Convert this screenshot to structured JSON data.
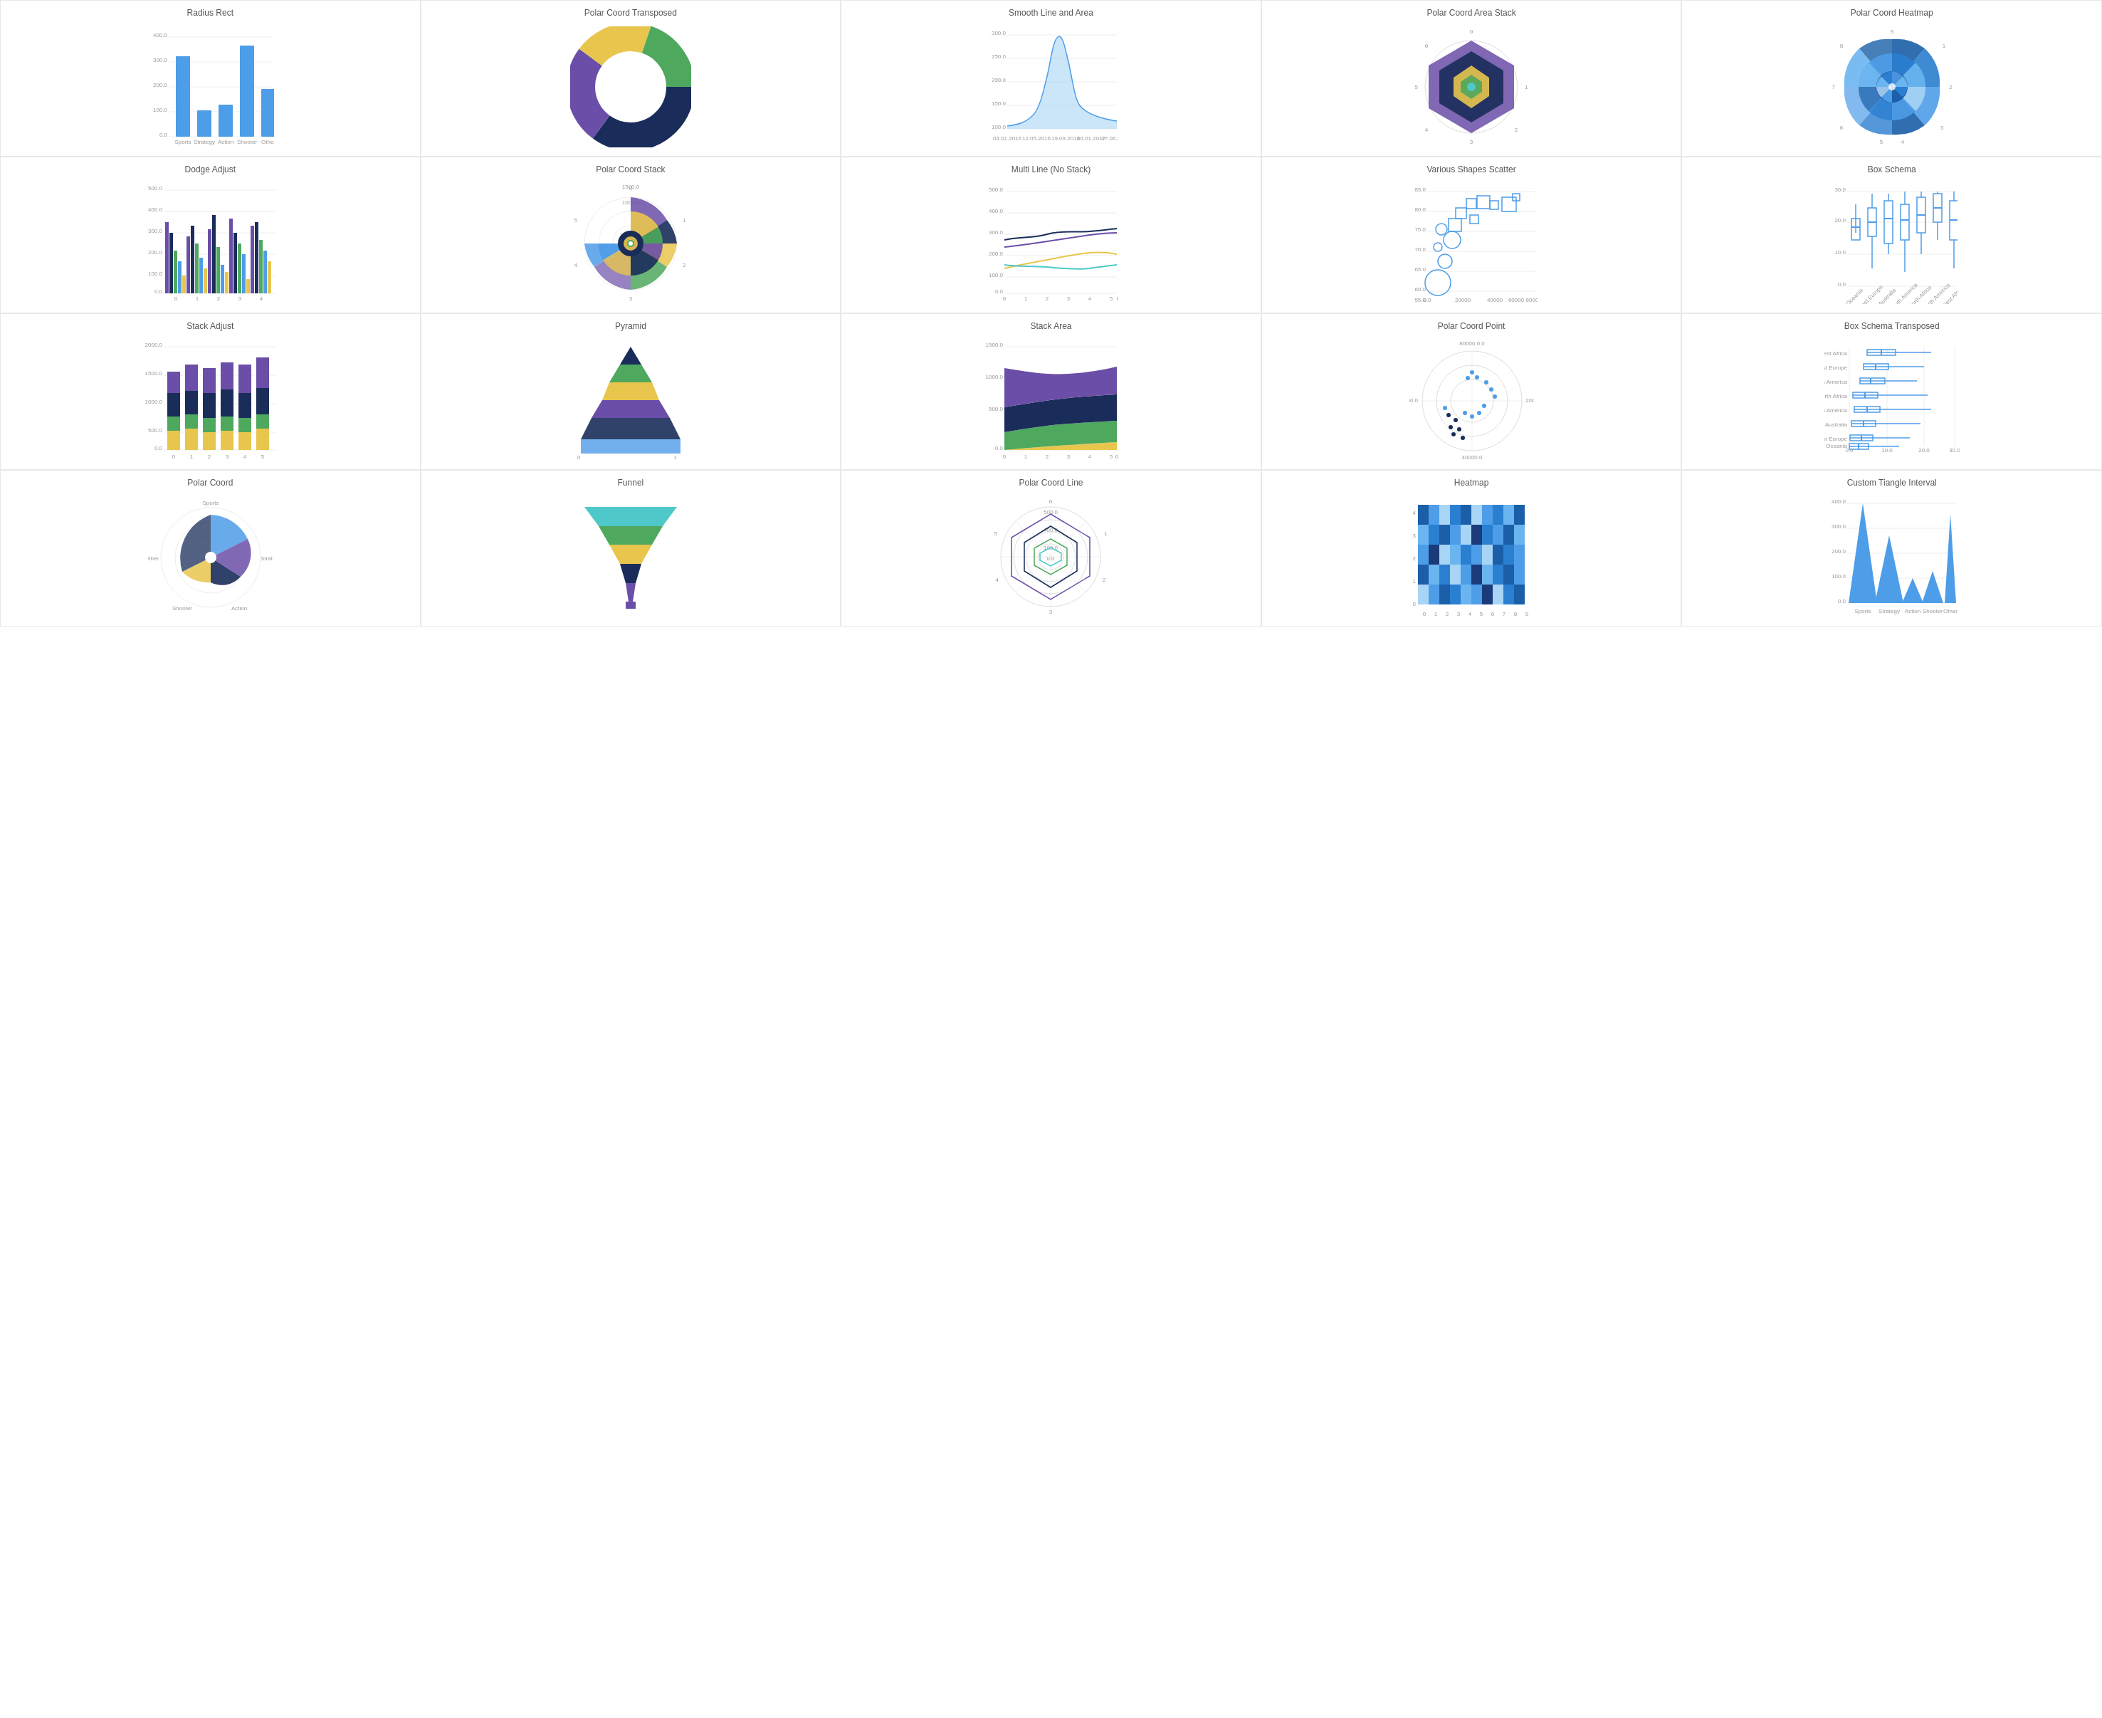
{
  "charts": [
    {
      "id": "radius-rect",
      "title": "Radius Rect",
      "type": "bar"
    },
    {
      "id": "polar-coord-transposed",
      "title": "Polar Coord Transposed",
      "type": "donut"
    },
    {
      "id": "smooth-line-area",
      "title": "Smooth Line and Area",
      "type": "area"
    },
    {
      "id": "polar-coord-area-stack",
      "title": "Polar Coord Area Stack",
      "type": "radar-area"
    },
    {
      "id": "polar-coord-heatmap",
      "title": "Polar Coord Heatmap",
      "type": "polar-heatmap"
    },
    {
      "id": "dodge-adjust",
      "title": "Dodge Adjust",
      "type": "grouped-bar"
    },
    {
      "id": "polar-coord-stack",
      "title": "Polar Coord Stack",
      "type": "polar-stack"
    },
    {
      "id": "multi-line",
      "title": "Multi Line (No Stack)",
      "type": "multi-line"
    },
    {
      "id": "various-shapes-scatter",
      "title": "Various Shapes Scatter",
      "type": "scatter"
    },
    {
      "id": "box-schema",
      "title": "Box Schema",
      "type": "box"
    },
    {
      "id": "stack-adjust",
      "title": "Stack Adjust",
      "type": "stacked-bar"
    },
    {
      "id": "pyramid",
      "title": "Pyramid",
      "type": "pyramid"
    },
    {
      "id": "stack-area",
      "title": "Stack Area",
      "type": "stack-area"
    },
    {
      "id": "polar-coord-point",
      "title": "Polar Coord Point",
      "type": "polar-point"
    },
    {
      "id": "box-schema-transposed",
      "title": "Box Schema Transposed",
      "type": "box-transposed"
    },
    {
      "id": "polar-coord",
      "title": "Polar Coord",
      "type": "polar-pie"
    },
    {
      "id": "funnel",
      "title": "Funnel",
      "type": "funnel"
    },
    {
      "id": "polar-coord-line",
      "title": "Polar Coord Line",
      "type": "polar-line"
    },
    {
      "id": "heatmap",
      "title": "Heatmap",
      "type": "heatmap"
    },
    {
      "id": "custom-triangle-interval",
      "title": "Custom Tiangle Interval",
      "type": "triangle"
    }
  ],
  "colors": {
    "blue": "#4e9de8",
    "purple": "#6b4ea8",
    "yellow": "#e8c64e",
    "green": "#4ea85e",
    "darkblue": "#1a2d5a",
    "teal": "#4ec8c8",
    "lightblue": "#a8d4f5"
  }
}
